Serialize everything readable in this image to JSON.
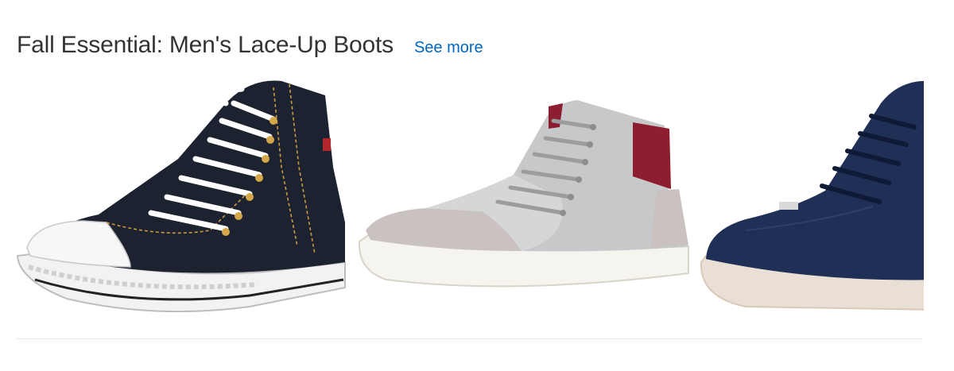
{
  "section": {
    "title": "Fall Essential: Men's Lace-Up Boots",
    "see_more_label": "See more"
  },
  "products": [
    {
      "icon": "denim-high-top-sneaker-image",
      "color": "#1c2230"
    },
    {
      "icon": "gray-burgundy-high-top-sneaker-image",
      "color": "#c6c8ca"
    },
    {
      "icon": "navy-leather-high-top-sneaker-image",
      "color": "#1f2f55"
    }
  ]
}
